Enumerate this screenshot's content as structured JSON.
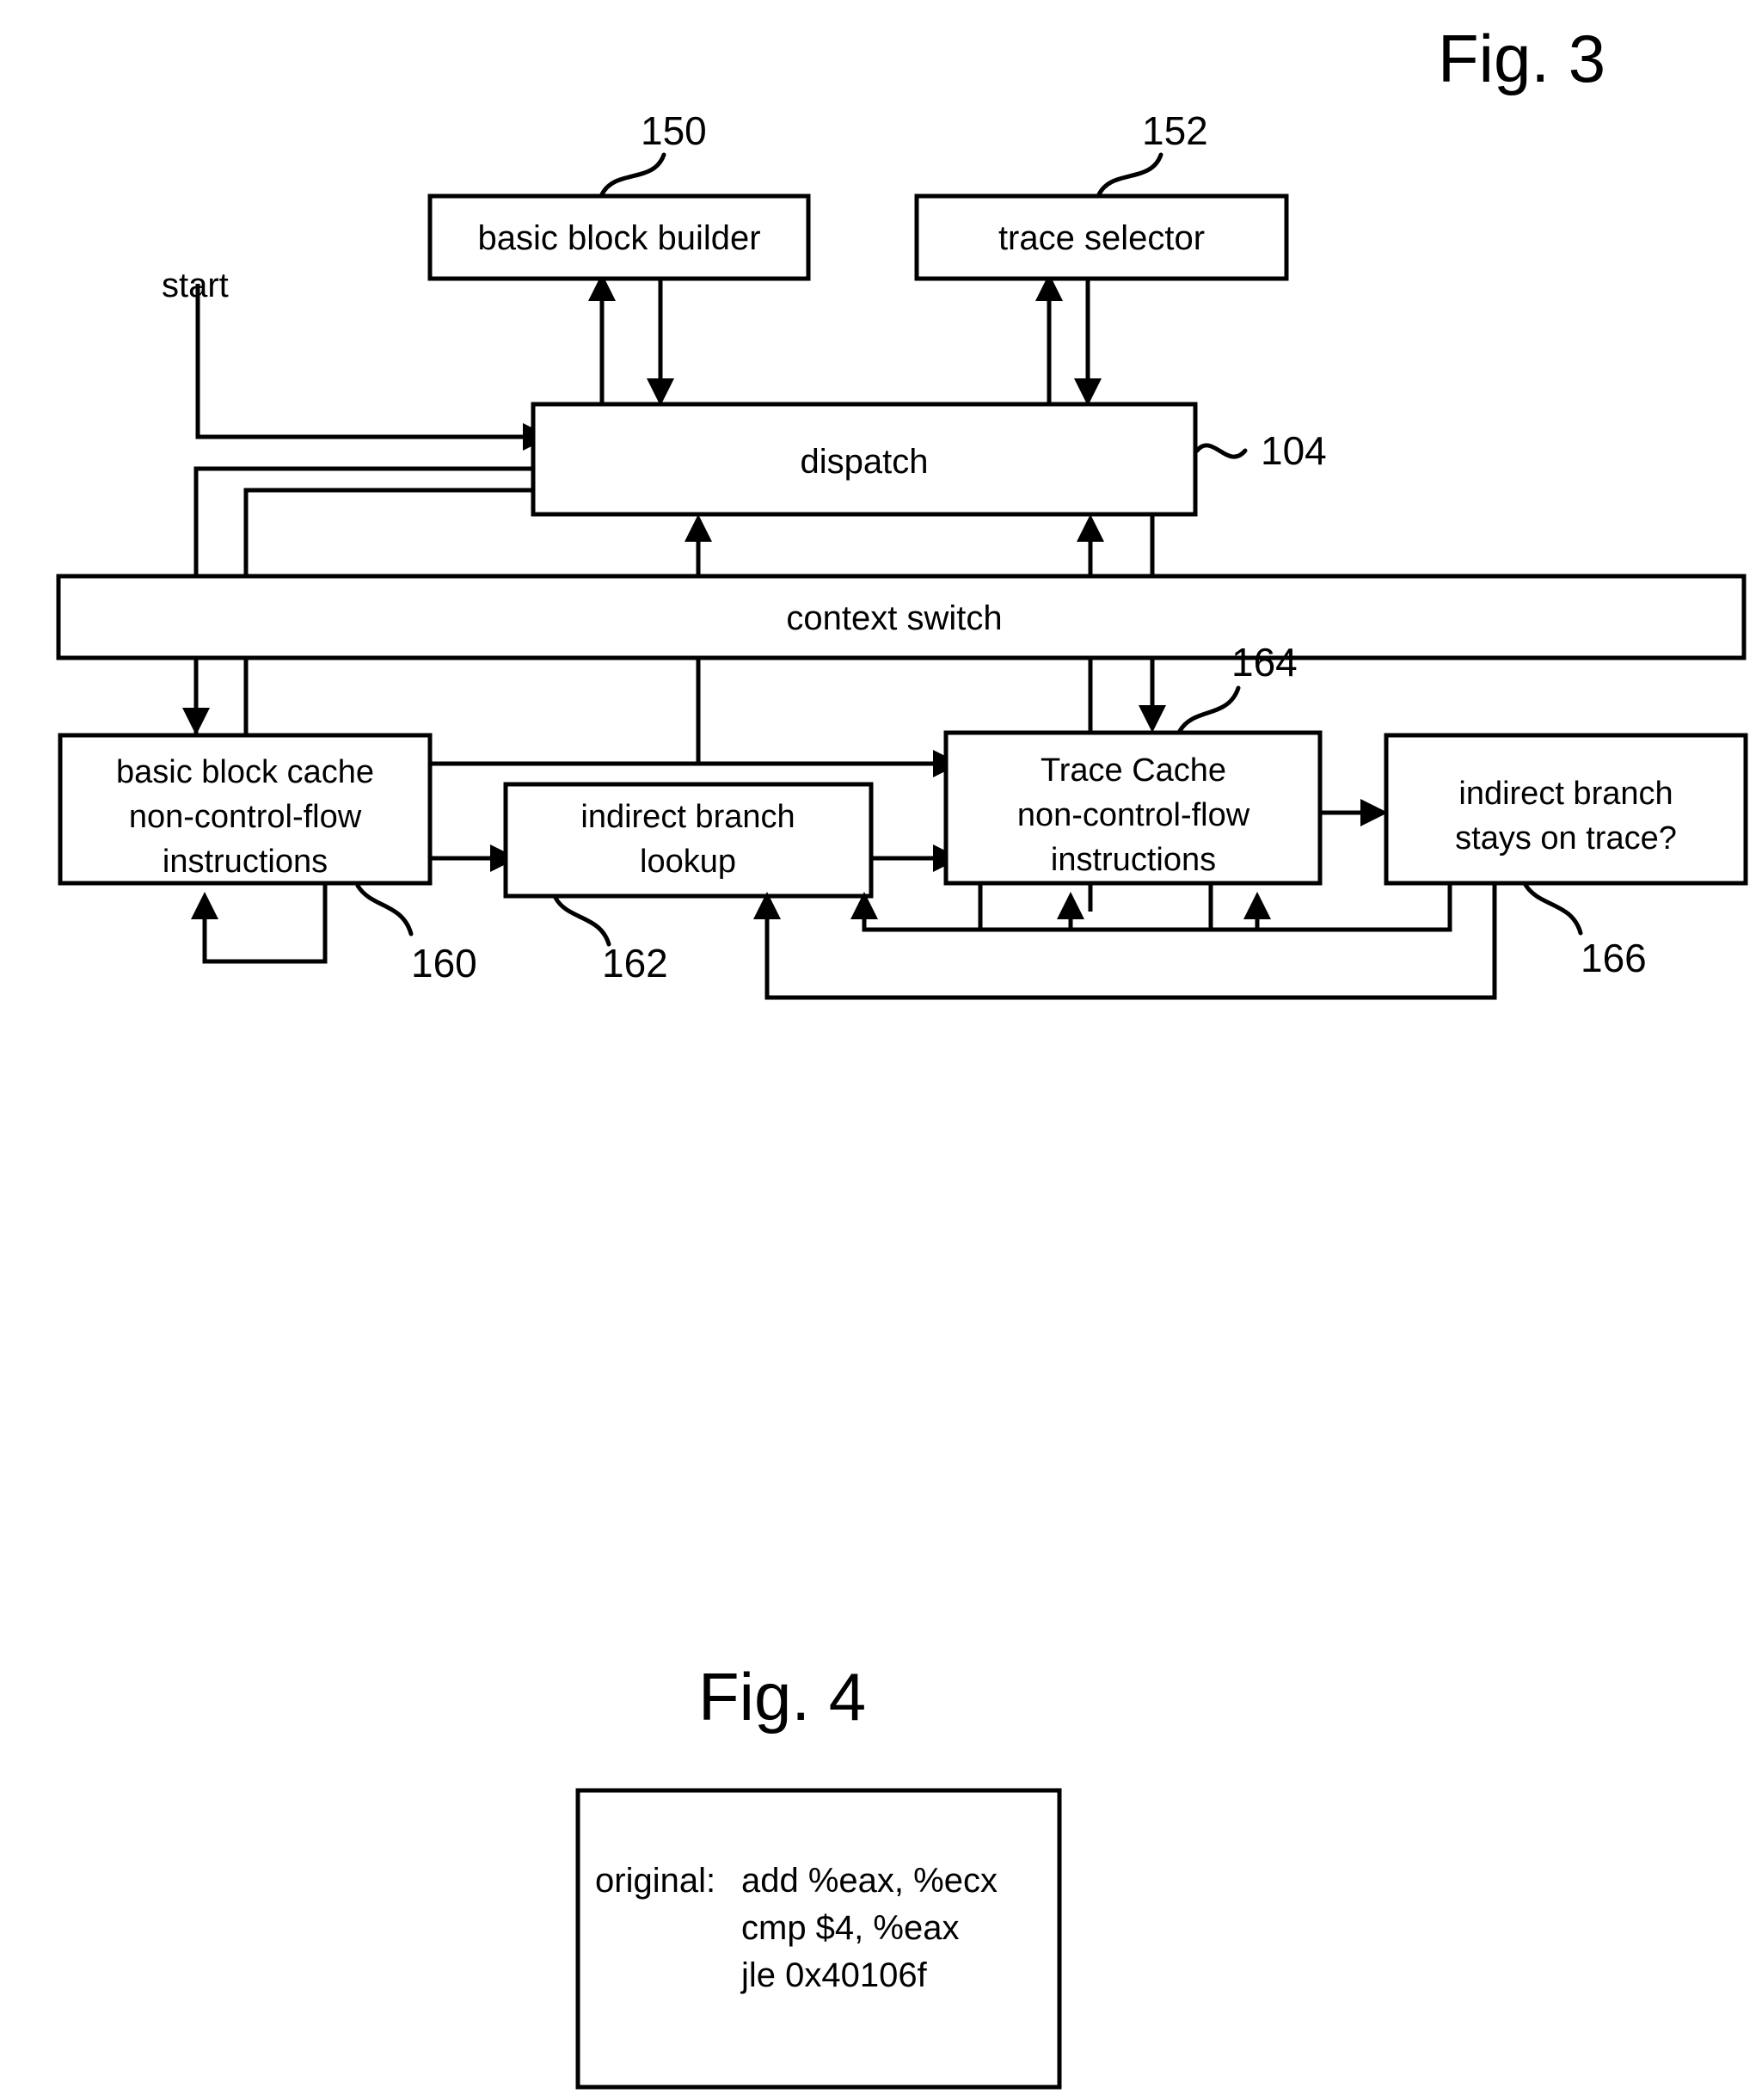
{
  "figures": [
    {
      "id": "fig3",
      "title": "Fig. 3",
      "nodes": {
        "basic_block_builder": {
          "label": "basic block builder",
          "ref": "150"
        },
        "trace_selector": {
          "label": "trace selector",
          "ref": "152"
        },
        "dispatch": {
          "label": "dispatch",
          "ref": "104"
        },
        "context_switch": {
          "label": "context switch",
          "ref": ""
        },
        "basic_block_cache": {
          "line1": "basic block cache",
          "line2": "non-control-flow",
          "line3": "instructions",
          "ref": "160"
        },
        "indirect_branch_lookup": {
          "line1": "indirect branch",
          "line2": "lookup",
          "ref": "162"
        },
        "trace_cache": {
          "line1": "Trace Cache",
          "line2": "non-control-flow",
          "line3": "instructions",
          "ref": "164"
        },
        "indirect_branch_stays_on_trace": {
          "line1": "indirect branch",
          "line2": "stays on trace?",
          "ref": "166"
        }
      },
      "annotations": {
        "start": "start"
      }
    },
    {
      "id": "fig4",
      "title": "Fig. 4",
      "code_box": {
        "lines": [
          {
            "label": "original:",
            "text": "add  %eax,  %ecx"
          },
          {
            "label": "",
            "text": "cmp $4,  %eax"
          },
          {
            "label": "",
            "text": "jle  0x40106f"
          }
        ]
      }
    }
  ],
  "colors": {
    "ink": "#000000",
    "paper": "#ffffff"
  }
}
